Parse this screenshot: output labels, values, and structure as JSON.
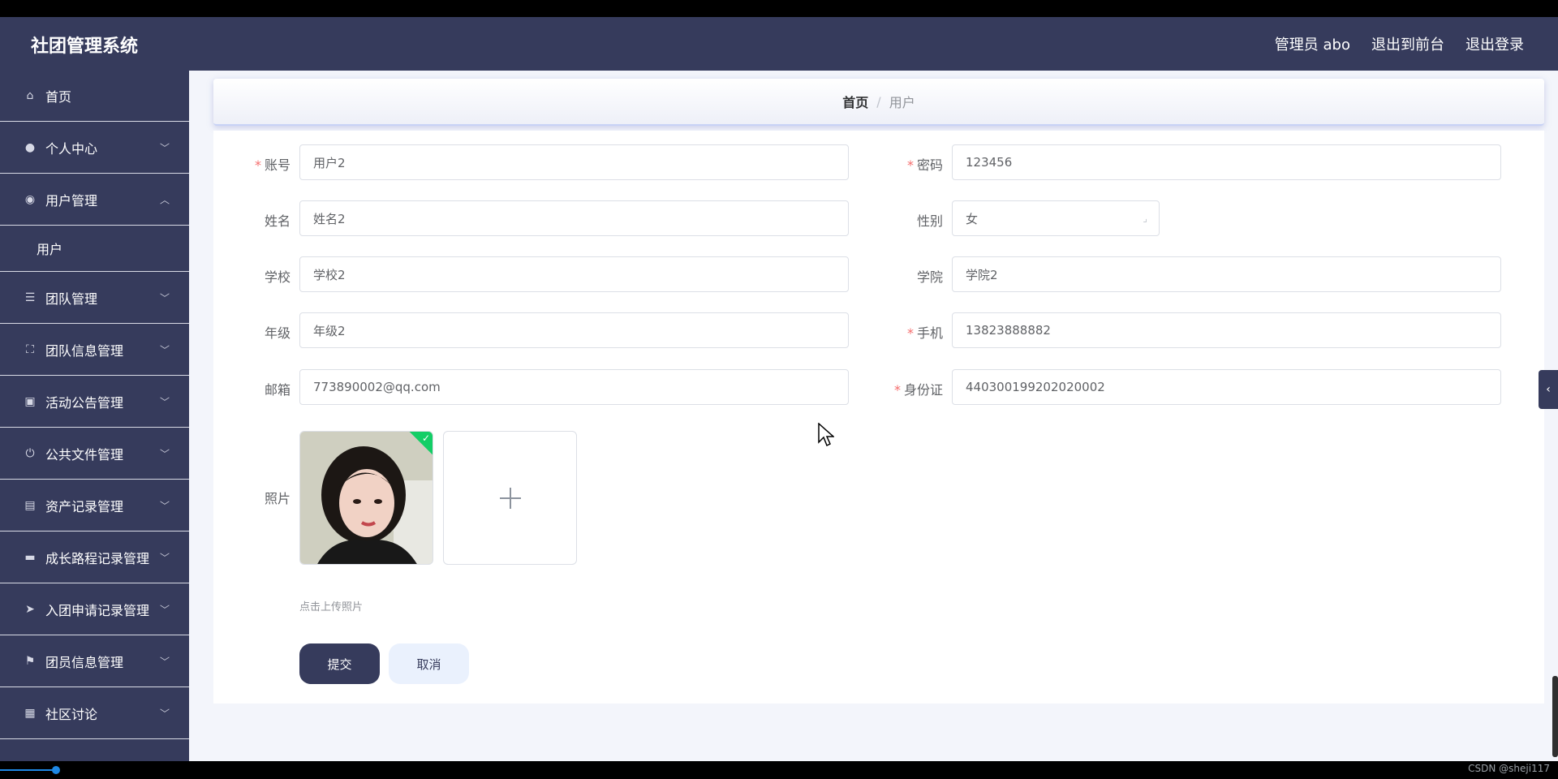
{
  "app": {
    "title": "社团管理系统"
  },
  "header": {
    "user": "管理员 abo",
    "to_frontend": "退出到前台",
    "logout": "退出登录"
  },
  "sidebar": {
    "items": [
      {
        "label": "首页",
        "icon": "home-icon"
      },
      {
        "label": "个人中心",
        "icon": "user-icon"
      },
      {
        "label": "用户管理",
        "icon": "pin-icon",
        "expanded": true,
        "children": [
          "用户"
        ]
      },
      {
        "label": "团队管理",
        "icon": "menu-icon"
      },
      {
        "label": "团队信息管理",
        "icon": "fullscreen-icon"
      },
      {
        "label": "活动公告管理",
        "icon": "clipboard-icon"
      },
      {
        "label": "公共文件管理",
        "icon": "power-icon"
      },
      {
        "label": "资产记录管理",
        "icon": "chart-icon"
      },
      {
        "label": "成长路程记录管理",
        "icon": "briefcase-icon"
      },
      {
        "label": "入团申请记录管理",
        "icon": "send-icon"
      },
      {
        "label": "团员信息管理",
        "icon": "flag-icon"
      },
      {
        "label": "社区讨论",
        "icon": "document-icon"
      }
    ]
  },
  "breadcrumb": {
    "home": "首页",
    "separator": "/",
    "current": "用户"
  },
  "form": {
    "account": {
      "label": "账号",
      "value": "用户2",
      "required": true
    },
    "password": {
      "label": "密码",
      "value": "123456",
      "required": true
    },
    "name": {
      "label": "姓名",
      "value": "姓名2"
    },
    "gender": {
      "label": "性别",
      "value": "女"
    },
    "school": {
      "label": "学校",
      "value": "学校2"
    },
    "college": {
      "label": "学院",
      "value": "学院2"
    },
    "grade": {
      "label": "年级",
      "value": "年级2"
    },
    "phone": {
      "label": "手机",
      "value": "13823888882",
      "required": true
    },
    "email": {
      "label": "邮箱",
      "value": "773890002@qq.com"
    },
    "id_card": {
      "label": "身份证",
      "value": "440300199202020002",
      "required": true
    },
    "photo": {
      "label": "照片",
      "hint": "点击上传照片",
      "uploaded": true
    },
    "submit": "提交",
    "cancel": "取消"
  },
  "footer": {
    "watermark": "CSDN @sheji117"
  },
  "colors": {
    "primary": "#363b5c",
    "required": "#f56c6c",
    "success": "#13ce66",
    "cancel_bg": "#eaf1fd"
  }
}
